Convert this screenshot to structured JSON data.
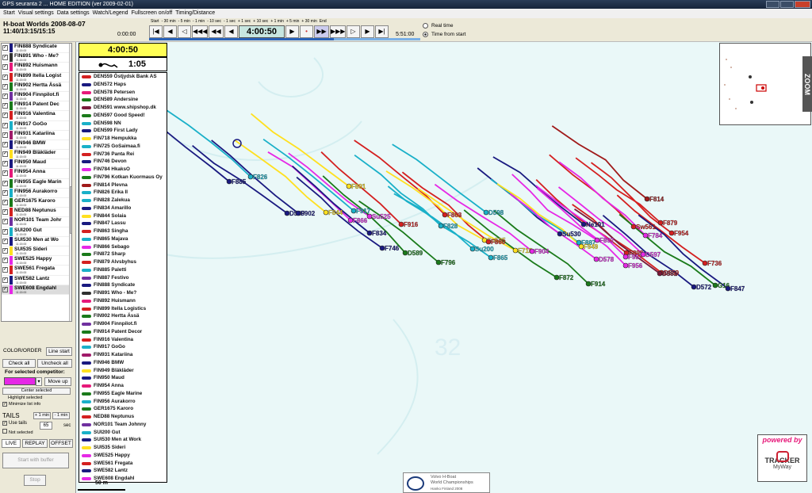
{
  "window": {
    "title": "GPS seuranta 2 ... HOME EDITION  (ver 2009-02-01)"
  },
  "menu": [
    "Start",
    "Visual settings",
    "Data settings",
    "Watch/Legend",
    "Fullscreen on/off",
    "Timing/Distance"
  ],
  "race": {
    "title": "H-boat Worlds 2008-08-07",
    "stamp": "11:40/13:15/15:15"
  },
  "playback": {
    "start_time": "0:00:00",
    "end_time": "5:51:00",
    "current_time": "4:00:50",
    "step_labels": [
      "Start",
      "- 30 min",
      "- 5 min",
      "- 1 min",
      "- 10 sec",
      "- 1 sec",
      "+ 1 sec",
      "+ 10 sec",
      "+ 1 min",
      "+ 5 min",
      "+ 30 min",
      "End"
    ],
    "progress": 0.68
  },
  "time_mode": {
    "options": [
      "Real time",
      "Time from start"
    ],
    "selected": "Time from start"
  },
  "competitors": [
    {
      "name": "FIN888 Syndicate",
      "color": "#1a1a80"
    },
    {
      "name": "FIN891 Who - Me?",
      "color": "#303030"
    },
    {
      "name": "FIN892 Huismann",
      "color": "#e6197a"
    },
    {
      "name": "FIN899 Itella Logist",
      "color": "#d42020"
    },
    {
      "name": "FIN902 Hertta Ässä",
      "color": "#1a7a1a"
    },
    {
      "name": "FIN904 Finnpilot.fi",
      "color": "#7030a0"
    },
    {
      "name": "FIN914 Patent Dec",
      "color": "#1a7a1a"
    },
    {
      "name": "FIN916 Valentina",
      "color": "#d42020"
    },
    {
      "name": "FIN917 GoGo",
      "color": "#1ab0c8"
    },
    {
      "name": "FIN931 Katariina",
      "color": "#a01a6a"
    },
    {
      "name": "FIN946 BMW",
      "color": "#1a1a80"
    },
    {
      "name": "FIN949 Bläkläder",
      "color": "#ffe020"
    },
    {
      "name": "FIN950 Maud",
      "color": "#1a1a80"
    },
    {
      "name": "FIN954 Anna",
      "color": "#e6197a"
    },
    {
      "name": "FIN955 Eagle Marin",
      "color": "#1a7a1a"
    },
    {
      "name": "FIN956 Aurakorro",
      "color": "#1ab0c8"
    },
    {
      "name": "GER1675 Karoro",
      "color": "#1a7a1a"
    },
    {
      "name": "NED88 Neptunus",
      "color": "#d42020"
    },
    {
      "name": "NOR101 Team Johr",
      "color": "#7030a0"
    },
    {
      "name": "SUI200 Gut",
      "color": "#1ab0c8"
    },
    {
      "name": "SUI530 Men at Wo",
      "color": "#1a1a80"
    },
    {
      "name": "SUI535 Sideri",
      "color": "#ffe020"
    },
    {
      "name": "SWE525 Happy",
      "color": "#e628e6"
    },
    {
      "name": "SWE561 Fregata",
      "color": "#d42020"
    },
    {
      "name": "SWE582 Lantz",
      "color": "#1a1a80"
    },
    {
      "name": "SWE608 Engdahl",
      "color": "#e628e6"
    }
  ],
  "competitor_time": "11:15:00",
  "left_panel": {
    "color_order_label": "COLOR/ORDER",
    "line_start_label": "Line start",
    "check_all": "Check all",
    "uncheck_all": "Uncheck all",
    "for_selected": "For selected competitor:",
    "move_up": "Move up",
    "center_selected": "Center selected",
    "highlight_selected": "Highlight selected",
    "minimize_list_info": "Minimize list info",
    "tails_label": "TAILS",
    "plus_1min": "+ 1 min",
    "minus_1min": "- 1 min",
    "use_tails": "Use tails",
    "tail_seconds": "65",
    "sec_label": "sec",
    "not_selected": "Not selected",
    "tabs": [
      "LIVE",
      "REPLAY",
      "OFFSET"
    ],
    "start_with_buffer": "Start with buffer",
    "stop": "Stop"
  },
  "map": {
    "time_display": "4:00:50",
    "lap_time": "1:05",
    "legend": [
      {
        "name": "DEN559 Östjydsk Bank AS",
        "color": "#d42020"
      },
      {
        "name": "DEN572 Haps",
        "color": "#1a1a80"
      },
      {
        "name": "DEN578 Petersen",
        "color": "#e6197a"
      },
      {
        "name": "DEN589 Andersine",
        "color": "#1a7a1a"
      },
      {
        "name": "DEN591 www.shipshop.dk",
        "color": "#7a1a3a"
      },
      {
        "name": "DEN597 Good Speed!",
        "color": "#1a7a1a"
      },
      {
        "name": "DEN598 NN",
        "color": "#1ab0c8"
      },
      {
        "name": "DEN599 First Lady",
        "color": "#1a1a80"
      },
      {
        "name": "FIN718 Hempukka",
        "color": "#ffe020"
      },
      {
        "name": "FIN725 GoSaimaa.fi",
        "color": "#1ab0c8"
      },
      {
        "name": "FIN736 Panta Rei",
        "color": "#d42020"
      },
      {
        "name": "FIN746 Devon",
        "color": "#1a1a80"
      },
      {
        "name": "FIN784 HkaksO",
        "color": "#e628e6"
      },
      {
        "name": "FIN796 Kotkan Kuormaus Oy",
        "color": "#1a7a1a"
      },
      {
        "name": "FIN814 Plevna",
        "color": "#a01a1a"
      },
      {
        "name": "FIN826 Erika II",
        "color": "#1ab0c8"
      },
      {
        "name": "FIN828 Zalekua",
        "color": "#1ab0c8"
      },
      {
        "name": "FIN834 Amarillo",
        "color": "#1a1a80"
      },
      {
        "name": "FIN844 Solaia",
        "color": "#ffe020"
      },
      {
        "name": "FIN847 Lassu",
        "color": "#1a1a80"
      },
      {
        "name": "FIN863 Singha",
        "color": "#d42020"
      },
      {
        "name": "FIN865 Majava",
        "color": "#1ab0c8"
      },
      {
        "name": "FIN866 Sebago",
        "color": "#e628e6"
      },
      {
        "name": "FIN872 Sharp",
        "color": "#1a7a1a"
      },
      {
        "name": "FIN879 Alvsbyhus",
        "color": "#d42020"
      },
      {
        "name": "FIN885 Paletti",
        "color": "#1ab0c8"
      },
      {
        "name": "FIN887 Festivo",
        "color": "#7030a0"
      },
      {
        "name": "FIN888 Syndicate",
        "color": "#1a1a80"
      },
      {
        "name": "FIN891 Who - Me?",
        "color": "#303030"
      },
      {
        "name": "FIN892 Huismann",
        "color": "#e6197a"
      },
      {
        "name": "FIN899 Itella Logistics",
        "color": "#d42020"
      },
      {
        "name": "FIN902 Hertta Ässä",
        "color": "#1a7a1a"
      },
      {
        "name": "FIN904 Finnpilot.fi",
        "color": "#7030a0"
      },
      {
        "name": "FIN914 Patent Decor",
        "color": "#1a7a1a"
      },
      {
        "name": "FIN916 Valentina",
        "color": "#d42020"
      },
      {
        "name": "FIN917 GoGo",
        "color": "#1ab0c8"
      },
      {
        "name": "FIN931 Katariina",
        "color": "#a01a6a"
      },
      {
        "name": "FIN946 BMW",
        "color": "#1a1a80"
      },
      {
        "name": "FIN949 Bläkläder",
        "color": "#ffe020"
      },
      {
        "name": "FIN950 Maud",
        "color": "#1a1a80"
      },
      {
        "name": "FIN954 Anna",
        "color": "#e6197a"
      },
      {
        "name": "FIN955 Eagle Marine",
        "color": "#1a7a1a"
      },
      {
        "name": "FIN956 Aurakorro",
        "color": "#1ab0c8"
      },
      {
        "name": "GER1675 Karoro",
        "color": "#1a7a1a"
      },
      {
        "name": "NED88 Neptunus",
        "color": "#d42020"
      },
      {
        "name": "NOR101 Team Johnny",
        "color": "#7030a0"
      },
      {
        "name": "SUI200 Gut",
        "color": "#1ab0c8"
      },
      {
        "name": "SUI530 Men at Work",
        "color": "#1a1a80"
      },
      {
        "name": "SUI535 Sideri",
        "color": "#ffe020"
      },
      {
        "name": "SWE525 Happy",
        "color": "#e628e6"
      },
      {
        "name": "SWE561 Fregata",
        "color": "#d42020"
      },
      {
        "name": "SWE582 Lantz",
        "color": "#1a1a80"
      },
      {
        "name": "SWE608 Engdahl",
        "color": "#e628e6"
      }
    ],
    "scale_label": "50 m",
    "zoom_label": "ZOOM",
    "boat_labels": [
      {
        "text": "F885",
        "color": "#1a1a80"
      },
      {
        "text": "F826",
        "color": "#1ab0c8"
      },
      {
        "text": "D599",
        "color": "#1a1a80"
      },
      {
        "text": "F902",
        "color": "#1a1a80"
      },
      {
        "text": "F844",
        "color": "#ffe020"
      },
      {
        "text": "F891",
        "color": "#ffe020"
      },
      {
        "text": "F917",
        "color": "#1ab0c8"
      },
      {
        "text": "F866",
        "color": "#e628e6"
      },
      {
        "text": "Su525",
        "color": "#e628e6"
      },
      {
        "text": "F834",
        "color": "#1a1a80"
      },
      {
        "text": "F916",
        "color": "#d42020"
      },
      {
        "text": "F746",
        "color": "#1a1a80"
      },
      {
        "text": "D589",
        "color": "#1a7a1a"
      },
      {
        "text": "F863",
        "color": "#d42020"
      },
      {
        "text": "F828",
        "color": "#1ab0c8"
      },
      {
        "text": "D598",
        "color": "#1ab0c8"
      },
      {
        "text": "F796",
        "color": "#1a7a1a"
      },
      {
        "text": "Su535",
        "color": "#ffe020"
      },
      {
        "text": "F860",
        "color": "#d42020"
      },
      {
        "text": "Su200",
        "color": "#1ab0c8"
      },
      {
        "text": "F865",
        "color": "#1ab0c8"
      },
      {
        "text": "F718",
        "color": "#ffe020"
      },
      {
        "text": "F904",
        "color": "#e628e6"
      },
      {
        "text": "Su530",
        "color": "#1a1a80"
      },
      {
        "text": "F887",
        "color": "#1ab0c8"
      },
      {
        "text": "Ne101",
        "color": "#1a1a80"
      },
      {
        "text": "F892",
        "color": "#e628e6"
      },
      {
        "text": "F949",
        "color": "#ffe020"
      },
      {
        "text": "D578",
        "color": "#e628e6"
      },
      {
        "text": "F899",
        "color": "#d42020"
      },
      {
        "text": "F957",
        "color": "#e628e6"
      },
      {
        "text": "F956",
        "color": "#e628e6"
      },
      {
        "text": "D597",
        "color": "#e628e6"
      },
      {
        "text": "D559",
        "color": "#d42020"
      },
      {
        "text": "F872",
        "color": "#1a7a1a"
      },
      {
        "text": "F914",
        "color": "#1a7a1a"
      },
      {
        "text": "F814",
        "color": "#a01a1a"
      },
      {
        "text": "F879",
        "color": "#d42020"
      },
      {
        "text": "Sw561",
        "color": "#d42020"
      },
      {
        "text": "F784",
        "color": "#e628e6"
      },
      {
        "text": "F954",
        "color": "#d42020"
      },
      {
        "text": "D591",
        "color": "#7a1a3a"
      },
      {
        "text": "F736",
        "color": "#d42020"
      },
      {
        "text": "D572",
        "color": "#1a1a80"
      },
      {
        "text": "G16",
        "color": "#1a7a1a"
      },
      {
        "text": "F847",
        "color": "#1a1a80"
      }
    ]
  },
  "sponsor": {
    "line1": "Volvo H-Boat",
    "line2": "World Championships",
    "line3": "Hanko Finland 2008"
  },
  "powered": {
    "line1": "powered by",
    "brand": "TRACKER",
    "sub": "MyWay"
  }
}
